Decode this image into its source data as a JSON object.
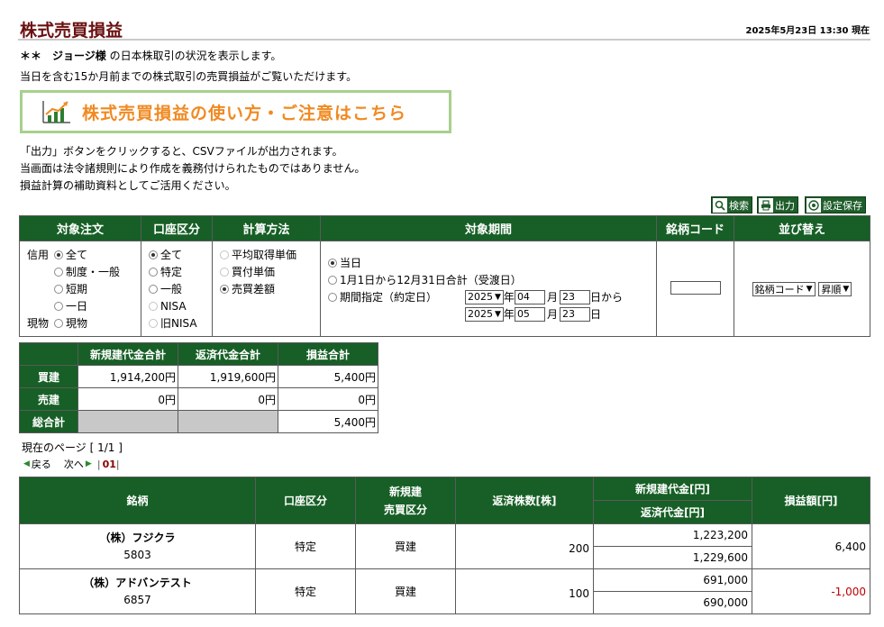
{
  "header": {
    "title": "株式売買損益",
    "timestamp": "2025年5月23日 13:30 現在"
  },
  "intro": {
    "user_prefix": "＊＊",
    "user_name": "ジョージ様",
    "line1_suffix": "の日本株取引の状況を表示します。",
    "line2": "当日を含む15か月前までの株式取引の売買損益がご覧いただけます。"
  },
  "guide_banner": {
    "label": "株式売買損益の使い方・ご注意はこちら",
    "icon": "chart-icon",
    "color": "#f08a22"
  },
  "notes": [
    "「出力」ボタンをクリックすると、CSVファイルが出力されます。",
    "当画面は法令諸規則により作成を義務付けられたものではありません。",
    "損益計算の補助資料としてご活用ください。"
  ],
  "toolbar": {
    "search_label": "検索",
    "output_label": "出力",
    "save_label": "設定保存"
  },
  "conditions": {
    "headers": [
      "対象注文",
      "口座区分",
      "計算方法",
      "対象期間",
      "銘柄コード",
      "並び替え"
    ],
    "order_groups": {
      "credit_label": "信用",
      "credit_options": [
        "全て",
        "制度・一般",
        "短期",
        "一日"
      ],
      "cash_label": "現物",
      "cash_option": "現物"
    },
    "account_options": [
      "全て",
      "特定",
      "一般",
      "NISA",
      "旧NISA"
    ],
    "calc_options": [
      "平均取得単価",
      "買付単価",
      "売買差額"
    ],
    "period_options": [
      "当日",
      "1月1日から12月31日合計（受渡日）",
      "期間指定（約定日）"
    ],
    "period_from": {
      "year": "2025",
      "month": "04",
      "day": "23",
      "year_unit": "年",
      "month_unit": "月",
      "suffix": "日から"
    },
    "period_to": {
      "year": "2025",
      "month": "05",
      "day": "23",
      "year_unit": "年",
      "month_unit": "月",
      "suffix": "日"
    },
    "code_value": "",
    "sort_key": "銘柄コード",
    "sort_order": "昇順"
  },
  "summary": {
    "headers": [
      "新規建代金合計",
      "返済代金合計",
      "損益合計"
    ],
    "rows": [
      {
        "label": "買建",
        "open": "1,914,200円",
        "close": "1,919,600円",
        "pl": "5,400円"
      },
      {
        "label": "売建",
        "open": "0円",
        "close": "0円",
        "pl": "0円"
      },
      {
        "label": "総合計",
        "open": "",
        "close": "",
        "pl": "5,400円"
      }
    ]
  },
  "pagination": {
    "current": "現在のページ [ 1/1 ]",
    "prev": "戻る",
    "next": "次へ",
    "page": "01"
  },
  "results": {
    "headers": {
      "name": "銘柄",
      "account": "口座区分",
      "trade_type_1": "新規建",
      "trade_type_2": "売買区分",
      "qty": "返済株数[株]",
      "open_amt": "新規建代金[円]",
      "close_amt": "返済代金[円]",
      "pl": "損益額[円]"
    },
    "rows": [
      {
        "name": "（株）フジクラ",
        "code": "5803",
        "account": "特定",
        "type": "買建",
        "qty": "200",
        "open": "1,223,200",
        "close": "1,229,600",
        "pl": "6,400"
      },
      {
        "name": "（株）アドバンテスト",
        "code": "6857",
        "account": "特定",
        "type": "買建",
        "qty": "100",
        "open": "691,000",
        "close": "690,000",
        "pl": "-1,000"
      }
    ]
  }
}
